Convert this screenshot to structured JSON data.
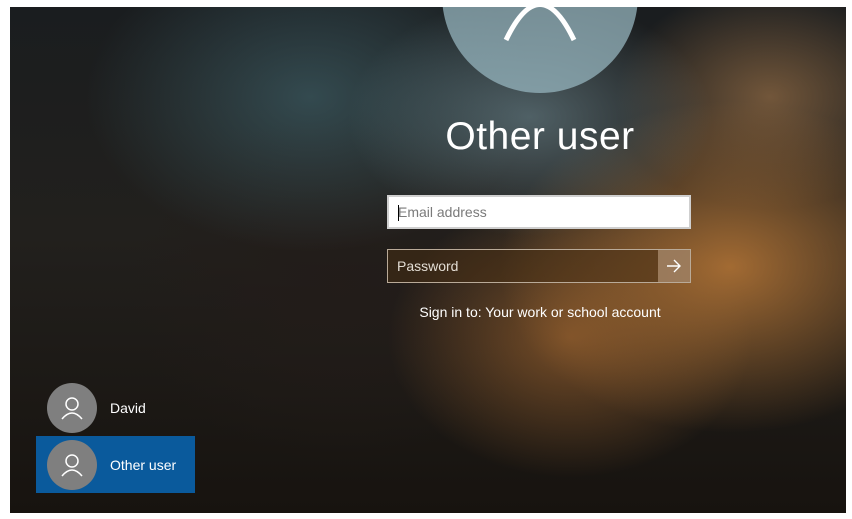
{
  "login": {
    "title": "Other user",
    "email_placeholder": "Email address",
    "password_placeholder": "Password",
    "signin_hint": "Sign in to: Your work or school account",
    "submit_icon": "arrow-right-icon"
  },
  "users": [
    {
      "name": "David",
      "icon": "person-icon",
      "selected": false
    },
    {
      "name": "Other user",
      "icon": "person-icon",
      "selected": true
    }
  ],
  "colors": {
    "selected_user_background": "#0a5a9c",
    "avatar_gray": "#7f7f7f",
    "text": "#ffffff"
  }
}
